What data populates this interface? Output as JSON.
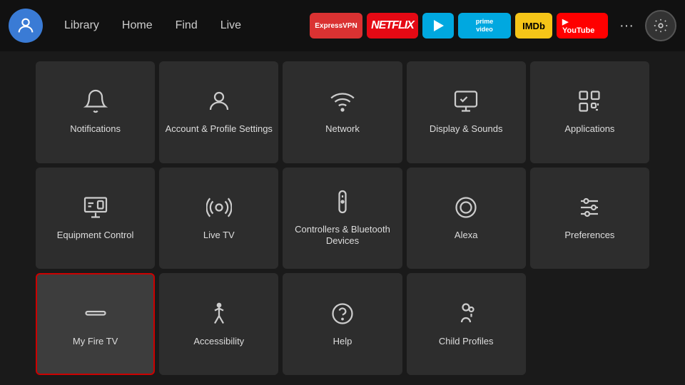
{
  "nav": {
    "links": [
      "Library",
      "Home",
      "Find",
      "Live"
    ],
    "apps": [
      {
        "name": "ExpressVPN",
        "class": "app-expressvpn",
        "label": "ExpressVPN"
      },
      {
        "name": "Netflix",
        "class": "app-netflix",
        "label": "NETFLIX"
      },
      {
        "name": "Freevee",
        "class": "app-freevee",
        "label": "▶"
      },
      {
        "name": "Prime Video",
        "class": "app-primevideo",
        "label": "prime video"
      },
      {
        "name": "IMDb TV",
        "class": "app-imdb",
        "label": "IMDb"
      },
      {
        "name": "YouTube",
        "class": "app-youtube",
        "label": "▶ YouTube"
      }
    ]
  },
  "grid": {
    "items": [
      {
        "id": "notifications",
        "label": "Notifications",
        "icon": "bell"
      },
      {
        "id": "account-profile",
        "label": "Account & Profile Settings",
        "icon": "person"
      },
      {
        "id": "network",
        "label": "Network",
        "icon": "wifi"
      },
      {
        "id": "display-sounds",
        "label": "Display & Sounds",
        "icon": "display"
      },
      {
        "id": "applications",
        "label": "Applications",
        "icon": "apps"
      },
      {
        "id": "equipment-control",
        "label": "Equipment Control",
        "icon": "monitor"
      },
      {
        "id": "live-tv",
        "label": "Live TV",
        "icon": "antenna"
      },
      {
        "id": "controllers-bluetooth",
        "label": "Controllers & Bluetooth Devices",
        "icon": "remote"
      },
      {
        "id": "alexa",
        "label": "Alexa",
        "icon": "alexa"
      },
      {
        "id": "preferences",
        "label": "Preferences",
        "icon": "sliders"
      },
      {
        "id": "my-fire-tv",
        "label": "My Fire TV",
        "icon": "firetv",
        "selected": true
      },
      {
        "id": "accessibility",
        "label": "Accessibility",
        "icon": "accessibility"
      },
      {
        "id": "help",
        "label": "Help",
        "icon": "help"
      },
      {
        "id": "child-profiles",
        "label": "Child Profiles",
        "icon": "child"
      }
    ]
  }
}
